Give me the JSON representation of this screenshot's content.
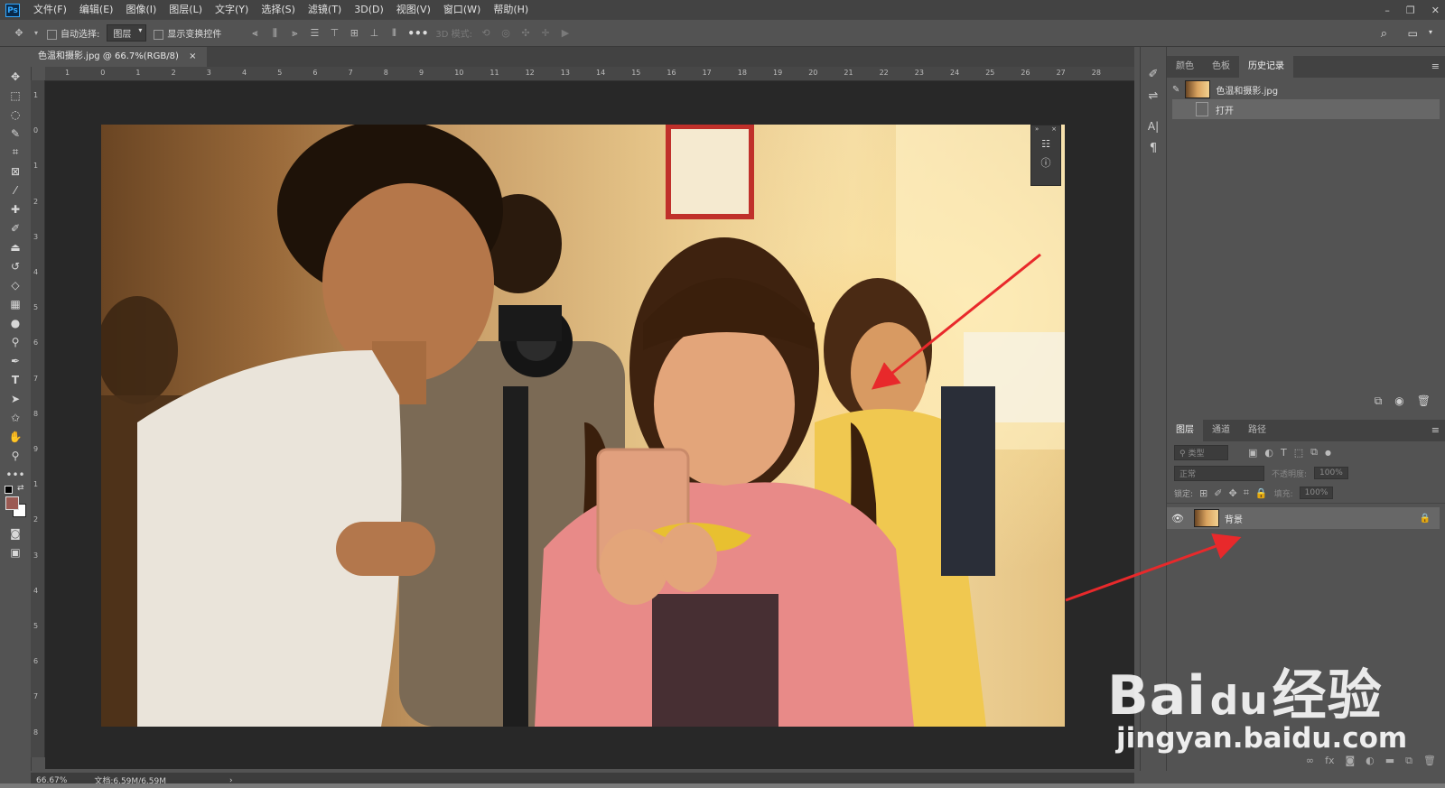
{
  "menubar": {
    "logo_text": "Ps",
    "items": [
      "文件(F)",
      "编辑(E)",
      "图像(I)",
      "图层(L)",
      "文字(Y)",
      "选择(S)",
      "滤镜(T)",
      "3D(D)",
      "视图(V)",
      "窗口(W)",
      "帮助(H)"
    ],
    "window_controls": {
      "minimize": "–",
      "restore": "❐",
      "close": "✕"
    }
  },
  "options": {
    "auto_select_label": "自动选择:",
    "auto_select_value": "图层",
    "show_transform_label": "显示变换控件",
    "more": "•••",
    "mode_3d_label": "3D 模式:"
  },
  "document": {
    "tab_title": "色温和摄影.jpg @ 66.7%(RGB/8)",
    "tab_close": "×",
    "hruler_labels": [
      "1",
      "0",
      "1",
      "2",
      "3",
      "4",
      "5",
      "6",
      "7",
      "8",
      "9",
      "10",
      "11",
      "12",
      "13",
      "14",
      "15",
      "16",
      "17",
      "18",
      "19",
      "20",
      "21",
      "22",
      "23",
      "24",
      "25",
      "26",
      "27",
      "28"
    ],
    "vruler_labels": [
      "1",
      "0",
      "1",
      "2",
      "3",
      "4",
      "5",
      "6",
      "7",
      "8",
      "9",
      "1",
      "2",
      "3",
      "4",
      "5",
      "6",
      "7",
      "8"
    ]
  },
  "status": {
    "zoom": "66.67%",
    "doc_size": "文档:6.59M/6.59M",
    "arrow": "›"
  },
  "history_panel": {
    "tabs": [
      "颜色",
      "色板",
      "历史记录"
    ],
    "active_tab": "历史记录",
    "snapshot_name": "色温和摄影.jpg",
    "steps": [
      "打开"
    ]
  },
  "layers_panel": {
    "tabs": [
      "图层",
      "通道",
      "路径"
    ],
    "active_tab": "图层",
    "filter_kind": "类型",
    "blend_mode": "正常",
    "opacity_label": "不透明度:",
    "opacity_value": "100%",
    "lock_label": "锁定:",
    "fill_label": "填充:",
    "fill_value": "100%",
    "layers": [
      {
        "name": "背景",
        "visible": true,
        "locked": true
      }
    ]
  },
  "watermark": {
    "brand_left": "Bai",
    "brand_paw": "du",
    "brand_right": "经验",
    "url": "jingyan.baidu.com"
  },
  "colors": {
    "annotation_arrow": "#e8292b",
    "foreground_swatch": "#9b5a53",
    "background_swatch": "#ffffff"
  }
}
